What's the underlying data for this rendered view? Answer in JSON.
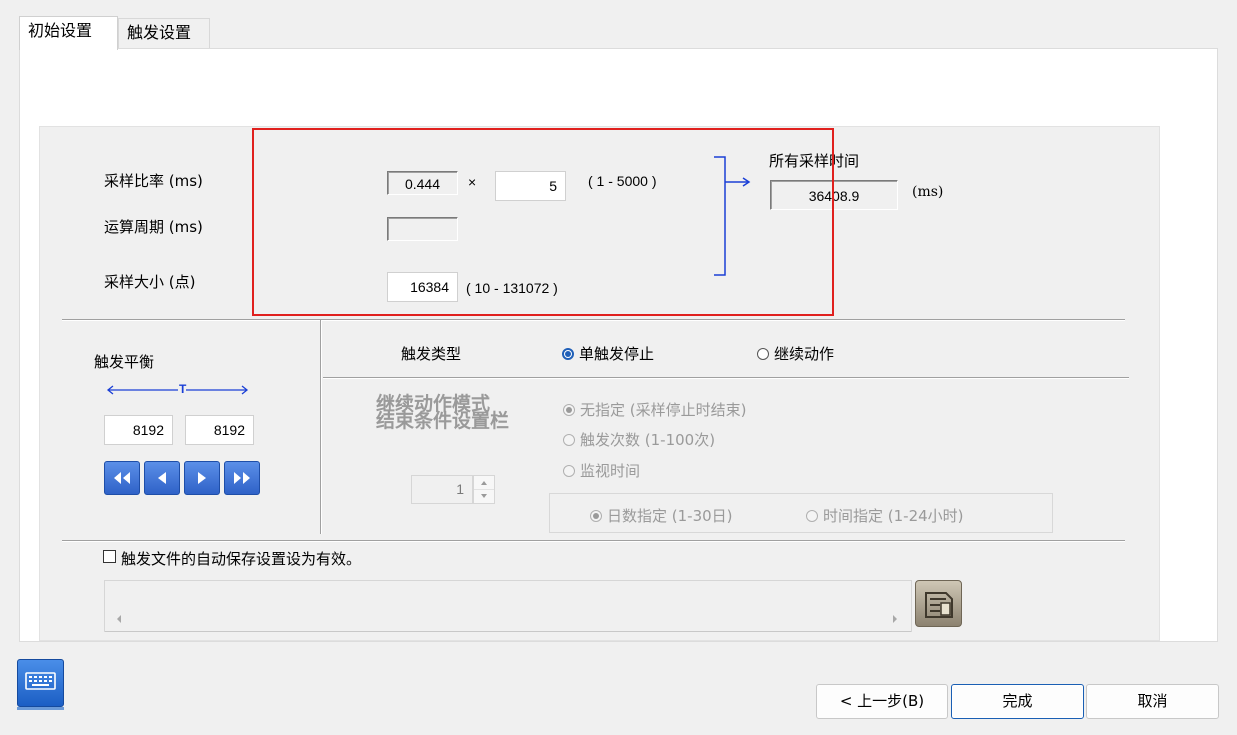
{
  "tabs": [
    {
      "label": "初始设置",
      "active": true
    },
    {
      "label": "触发设置",
      "active": false
    }
  ],
  "sampling": {
    "rate_label": "采样比率 (ms)",
    "cycle_label": "运算周期 (ms)",
    "size_label": "采样大小 (点)",
    "base_rate": "0.444",
    "multiply_sign": "×",
    "multiplier": "5",
    "multiplier_range": "( 1 - 5000 )",
    "cycle_value": "",
    "size_value": "16384",
    "size_range": "( 10 - 131072 )",
    "total_time_label": "所有采样时间",
    "total_time_value": "36408.9",
    "total_time_unit": "(ms)"
  },
  "trigger_balance": {
    "title": "触发平衡",
    "marker": "T",
    "left_value": "8192",
    "right_value": "8192",
    "nav_buttons": [
      "double-left-icon",
      "left-icon",
      "right-icon",
      "double-right-icon"
    ]
  },
  "trigger_type": {
    "label": "触发类型",
    "options": [
      {
        "label": "单触发停止",
        "selected": true
      },
      {
        "label": "继续动作",
        "selected": false
      }
    ]
  },
  "continuous_mode": {
    "title_line1": "继续动作模式",
    "title_line2": "结束条件设置栏",
    "options": [
      {
        "label": "无指定 (采样停止时结束)",
        "selected": true
      },
      {
        "label": "触发次数 (1-100次)",
        "selected": false
      },
      {
        "label": "监视时间",
        "selected": false
      }
    ],
    "spin_value": "1",
    "monitor_options": [
      {
        "label": "日数指定 (1-30日)",
        "selected": true
      },
      {
        "label": "时间指定 (1-24小时)",
        "selected": false
      }
    ]
  },
  "autosave": {
    "checkbox_label": "触发文件的自动保存设置设为有效。",
    "checked": false,
    "path_value": ""
  },
  "footer": {
    "back_label": "< 上一步(B)",
    "finish_label": "完成",
    "cancel_label": "取消"
  },
  "colors": {
    "highlight_box": "#e0201e",
    "bracket": "#1a3fd6",
    "accent": "#1f5fb8"
  }
}
